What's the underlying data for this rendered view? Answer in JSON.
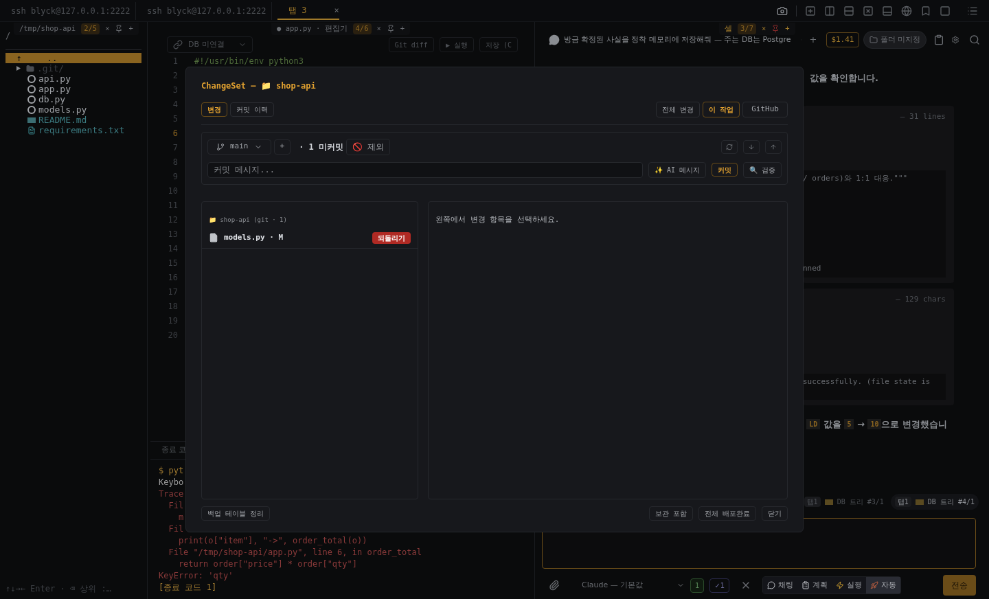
{
  "terminal_tabs": [
    {
      "label": "ssh blyck@127.0.0.1:2222",
      "selected": false
    },
    {
      "label": "ssh blyck@127.0.0.1:2222",
      "selected": false
    },
    {
      "label": "탭 3",
      "selected": true,
      "close": "×"
    }
  ],
  "floating_tabs": [
    {
      "label": "/tmp/shop-api",
      "count": "2/5",
      "close": "×",
      "add": "+"
    },
    {
      "label": "● app.py · 편집기",
      "count": "4/6",
      "close": "×",
      "add": "+"
    },
    {
      "label": "셀",
      "count": "3/7",
      "close": "×",
      "add": "+"
    }
  ],
  "file_panel": {
    "path": "/",
    "items": [
      {
        "name": "..",
        "icon": "↑",
        "kind": "up",
        "selected": true
      },
      {
        "name": ".git/",
        "kind": "folder",
        "selected": false,
        "expanded": false
      },
      {
        "name": "api.py",
        "kind": "python",
        "selected": false
      },
      {
        "name": "app.py",
        "kind": "python",
        "selected": false
      },
      {
        "name": "db.py",
        "kind": "python",
        "selected": false
      },
      {
        "name": "models.py",
        "kind": "python",
        "selected": false
      },
      {
        "name": "README.md",
        "kind": "markdown",
        "selected": false
      },
      {
        "name": "requirements.txt",
        "kind": "text",
        "selected": false
      }
    ],
    "hint": "↑↓→← Enter · ⌫ 상위 :…"
  },
  "editor": {
    "db": "DB 미연결",
    "buttons": [
      "Git diff",
      "▶ 실행",
      "저장 (C"
    ],
    "lines": [
      {
        "number": "1",
        "text": "#!/usr/bin/env python3",
        "current": false
      },
      {
        "number": "2",
        "current": false
      },
      {
        "number": "3",
        "current": false
      },
      {
        "number": "4",
        "current": false
      },
      {
        "number": "5",
        "current": false
      },
      {
        "number": "6",
        "current": true
      },
      {
        "number": "7",
        "current": false
      },
      {
        "number": "8",
        "current": false
      },
      {
        "number": "9",
        "current": false
      },
      {
        "number": "10",
        "current": false
      },
      {
        "number": "11",
        "current": false
      },
      {
        "number": "12",
        "current": false
      },
      {
        "number": "13",
        "current": false
      },
      {
        "number": "14",
        "current": false
      },
      {
        "number": "15",
        "current": false
      },
      {
        "number": "16",
        "current": false
      },
      {
        "number": "17",
        "current": false
      },
      {
        "number": "18",
        "current": false
      },
      {
        "number": "19",
        "current": false
      },
      {
        "number": "20",
        "current": false
      }
    ]
  },
  "terminal": {
    "title": "종료 코",
    "lines": [
      {
        "text": "$ pyt",
        "kind": "prompt"
      },
      {
        "text": "Keybo",
        "kind": "plain"
      },
      {
        "text": "Trace",
        "kind": "error"
      },
      {
        "text": "  Fil",
        "kind": "error"
      },
      {
        "text": "    m",
        "kind": "error"
      },
      {
        "text": "  Fil",
        "kind": "error"
      },
      {
        "text": "    print(o[\"item\"], \"->\", order_total(o))",
        "kind": "error"
      },
      {
        "text": "  File \"/tmp/shop-api/app.py\", line 6, in order_total",
        "kind": "error"
      },
      {
        "text": "    return order[\"price\"] * order[\"qty\"]",
        "kind": "error"
      },
      {
        "text": "KeyError: 'qty'",
        "kind": "error"
      },
      {
        "text": "[종료 코드 1]",
        "kind": "prompt"
      }
    ]
  },
  "chat": {
    "title": "방금 확정된 사실을 정착 메모리에 저장해줘 — 주는 DB는 Postgre",
    "add": "+",
    "cost": "$1.41",
    "folder": "폴더 미지정",
    "intro": "값을 확인합니다.",
    "tool_blocks": [
      {
        "meta": "— 31 lines",
        "output": [
          "/ orders)와 1:1 대응.\"\"\"",
          "nned"
        ]
      },
      {
        "meta": "— 129 chars",
        "output": [
          "successfully. (file state is"
        ]
      }
    ],
    "summary": [
      {
        "text": "LD",
        "kind": "code"
      },
      {
        "text": " 값을 ",
        "kind": "plain"
      },
      {
        "text": "5",
        "kind": "code"
      },
      {
        "text": " → ",
        "kind": "plain"
      },
      {
        "text": "10",
        "kind": "code"
      },
      {
        "text": "으로 변경했습니",
        "kind": "plain"
      }
    ],
    "tabs": [
      {
        "badge": "탭1",
        "label": "DB 트리 #3/1",
        "selected": false
      },
      {
        "badge": "탭1",
        "label": "DB 트리 #4/1",
        "selected": true
      }
    ],
    "model": "Claude — 기본값",
    "counts": [
      "1",
      "✓1"
    ],
    "modes": [
      {
        "label": "채팅",
        "selected": false
      },
      {
        "label": "계획",
        "selected": false
      },
      {
        "label": "실행",
        "selected": false
      },
      {
        "label": "자동",
        "selected": true
      }
    ],
    "send": "전송"
  },
  "dialog": {
    "title": "ChangeSet — 📁 shop-api",
    "tabs": [
      {
        "label": "변경",
        "selected": true
      },
      {
        "label": "커밋 이력",
        "selected": false
      }
    ],
    "scopes": [
      {
        "label": "전체 변경",
        "selected": false
      },
      {
        "label": "이 작업",
        "selected": true
      },
      {
        "label": "GitHub",
        "selected": false
      }
    ],
    "branch": "main",
    "add": "+",
    "uncommitted": "· 1 미커밋",
    "exclude": "🚫 제외",
    "commit_placeholder": "커밋 메시지...",
    "ai_message": "✨ AI 메시지",
    "commit": "커밋",
    "verify": "🔍 검증",
    "repo": "📁 shop-api (git · 1)",
    "files": [
      {
        "name": "models.py · M",
        "action": "되돌리기"
      }
    ],
    "empty": "왼쪽에서 변경 항목을 선택하세요.",
    "footer_left": "백업 테이블 정리",
    "footer": [
      "보관 포함",
      "전체 배포완료",
      "닫기"
    ]
  }
}
